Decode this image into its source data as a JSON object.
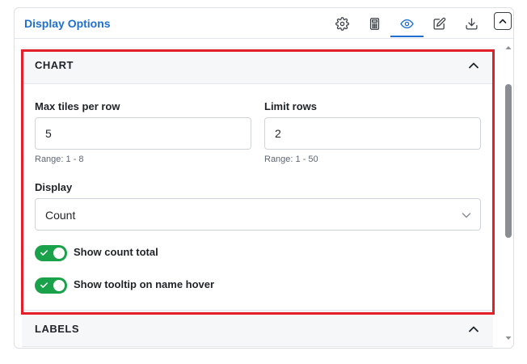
{
  "header": {
    "title": "Display Options",
    "icons": [
      "gear-icon",
      "calculator-icon",
      "eye-icon",
      "edit-icon",
      "download-icon"
    ],
    "active_tab": "eye-icon",
    "collapse_icon": "chevron-up-icon"
  },
  "chart_section": {
    "title": "CHART",
    "max_tiles": {
      "label": "Max tiles per row",
      "value": "5",
      "hint": "Range: 1 - 8"
    },
    "limit_rows": {
      "label": "Limit rows",
      "value": "2",
      "hint": "Range: 1 - 50"
    },
    "display": {
      "label": "Display",
      "selected": "Count"
    },
    "toggles": [
      {
        "label": "Show count total",
        "on": true
      },
      {
        "label": "Show tooltip on name hover",
        "on": true
      }
    ]
  },
  "labels_section": {
    "title": "LABELS"
  },
  "colors": {
    "accent": "#1f6fd0",
    "toggle_on": "#1aa24a",
    "highlight": "#e3202a"
  }
}
